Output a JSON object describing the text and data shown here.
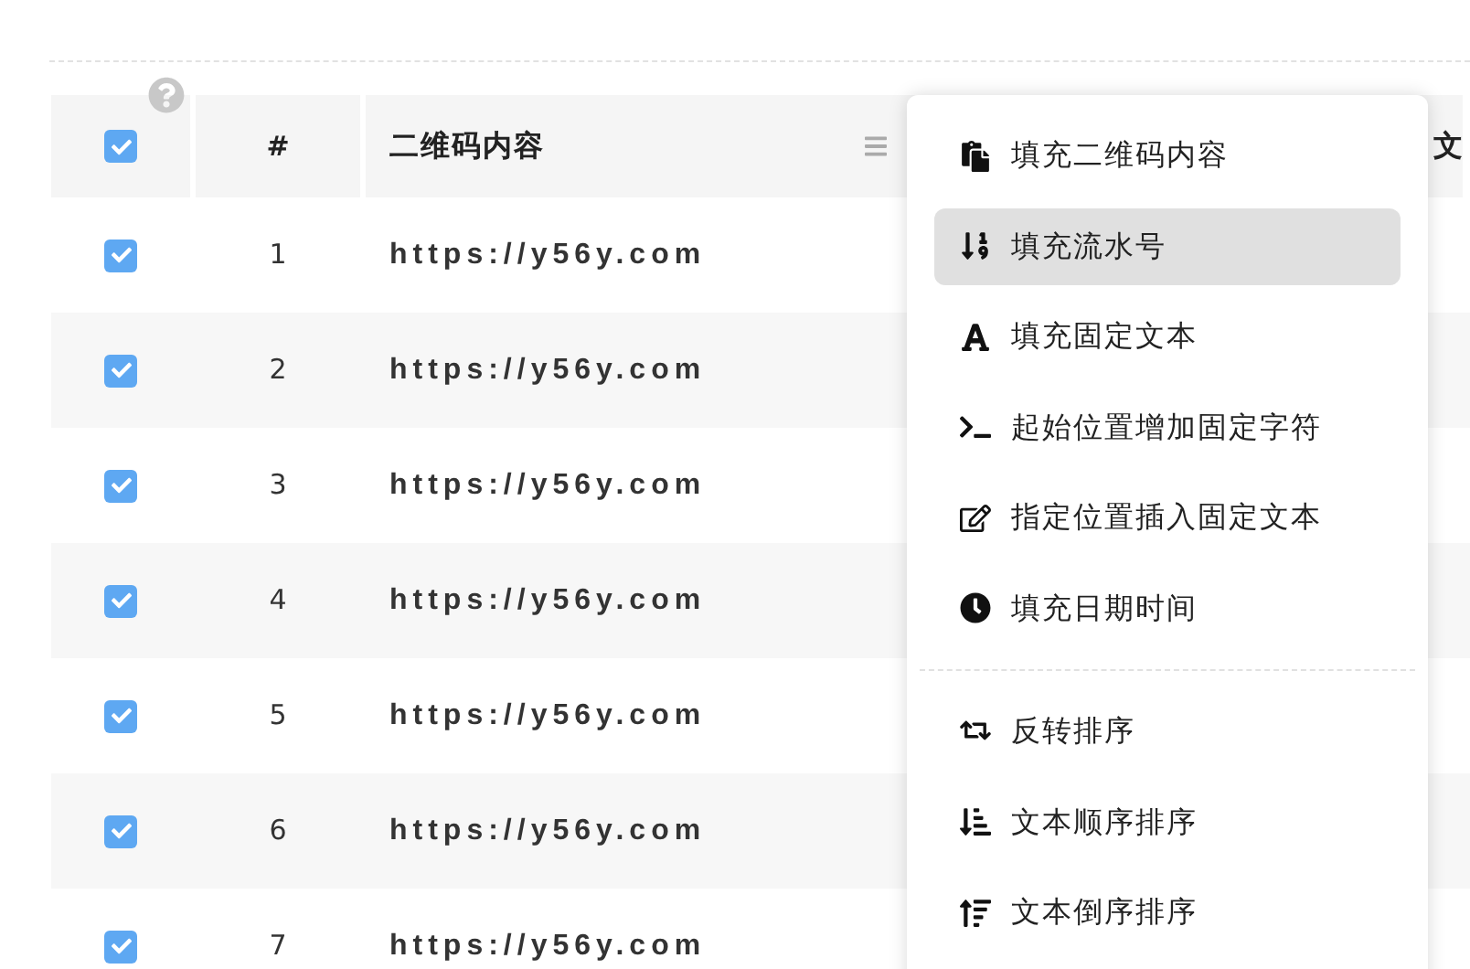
{
  "table": {
    "header_checkbox": {
      "checked": true
    },
    "columns": [
      "#",
      "二维码内容",
      "文"
    ],
    "rows": [
      {
        "checked": true,
        "index": "1",
        "content": "https://y56y.com"
      },
      {
        "checked": true,
        "index": "2",
        "content": "https://y56y.com"
      },
      {
        "checked": true,
        "index": "3",
        "content": "https://y56y.com"
      },
      {
        "checked": true,
        "index": "4",
        "content": "https://y56y.com"
      },
      {
        "checked": true,
        "index": "5",
        "content": "https://y56y.com"
      },
      {
        "checked": true,
        "index": "6",
        "content": "https://y56y.com"
      },
      {
        "checked": true,
        "index": "7",
        "content": "https://y56y.com"
      }
    ]
  },
  "menu": {
    "groups": [
      [
        {
          "label": "填充二维码内容",
          "selected": false
        },
        {
          "label": "填充流水号",
          "selected": true
        },
        {
          "label": "填充固定文本",
          "selected": false
        },
        {
          "label": "起始位置增加固定字符",
          "selected": false
        },
        {
          "label": "指定位置插入固定文本",
          "selected": false
        },
        {
          "label": "填充日期时间",
          "selected": false
        }
      ],
      [
        {
          "label": "反转排序",
          "selected": false
        },
        {
          "label": "文本顺序排序",
          "selected": false
        },
        {
          "label": "文本倒序排序",
          "selected": false
        }
      ]
    ]
  }
}
